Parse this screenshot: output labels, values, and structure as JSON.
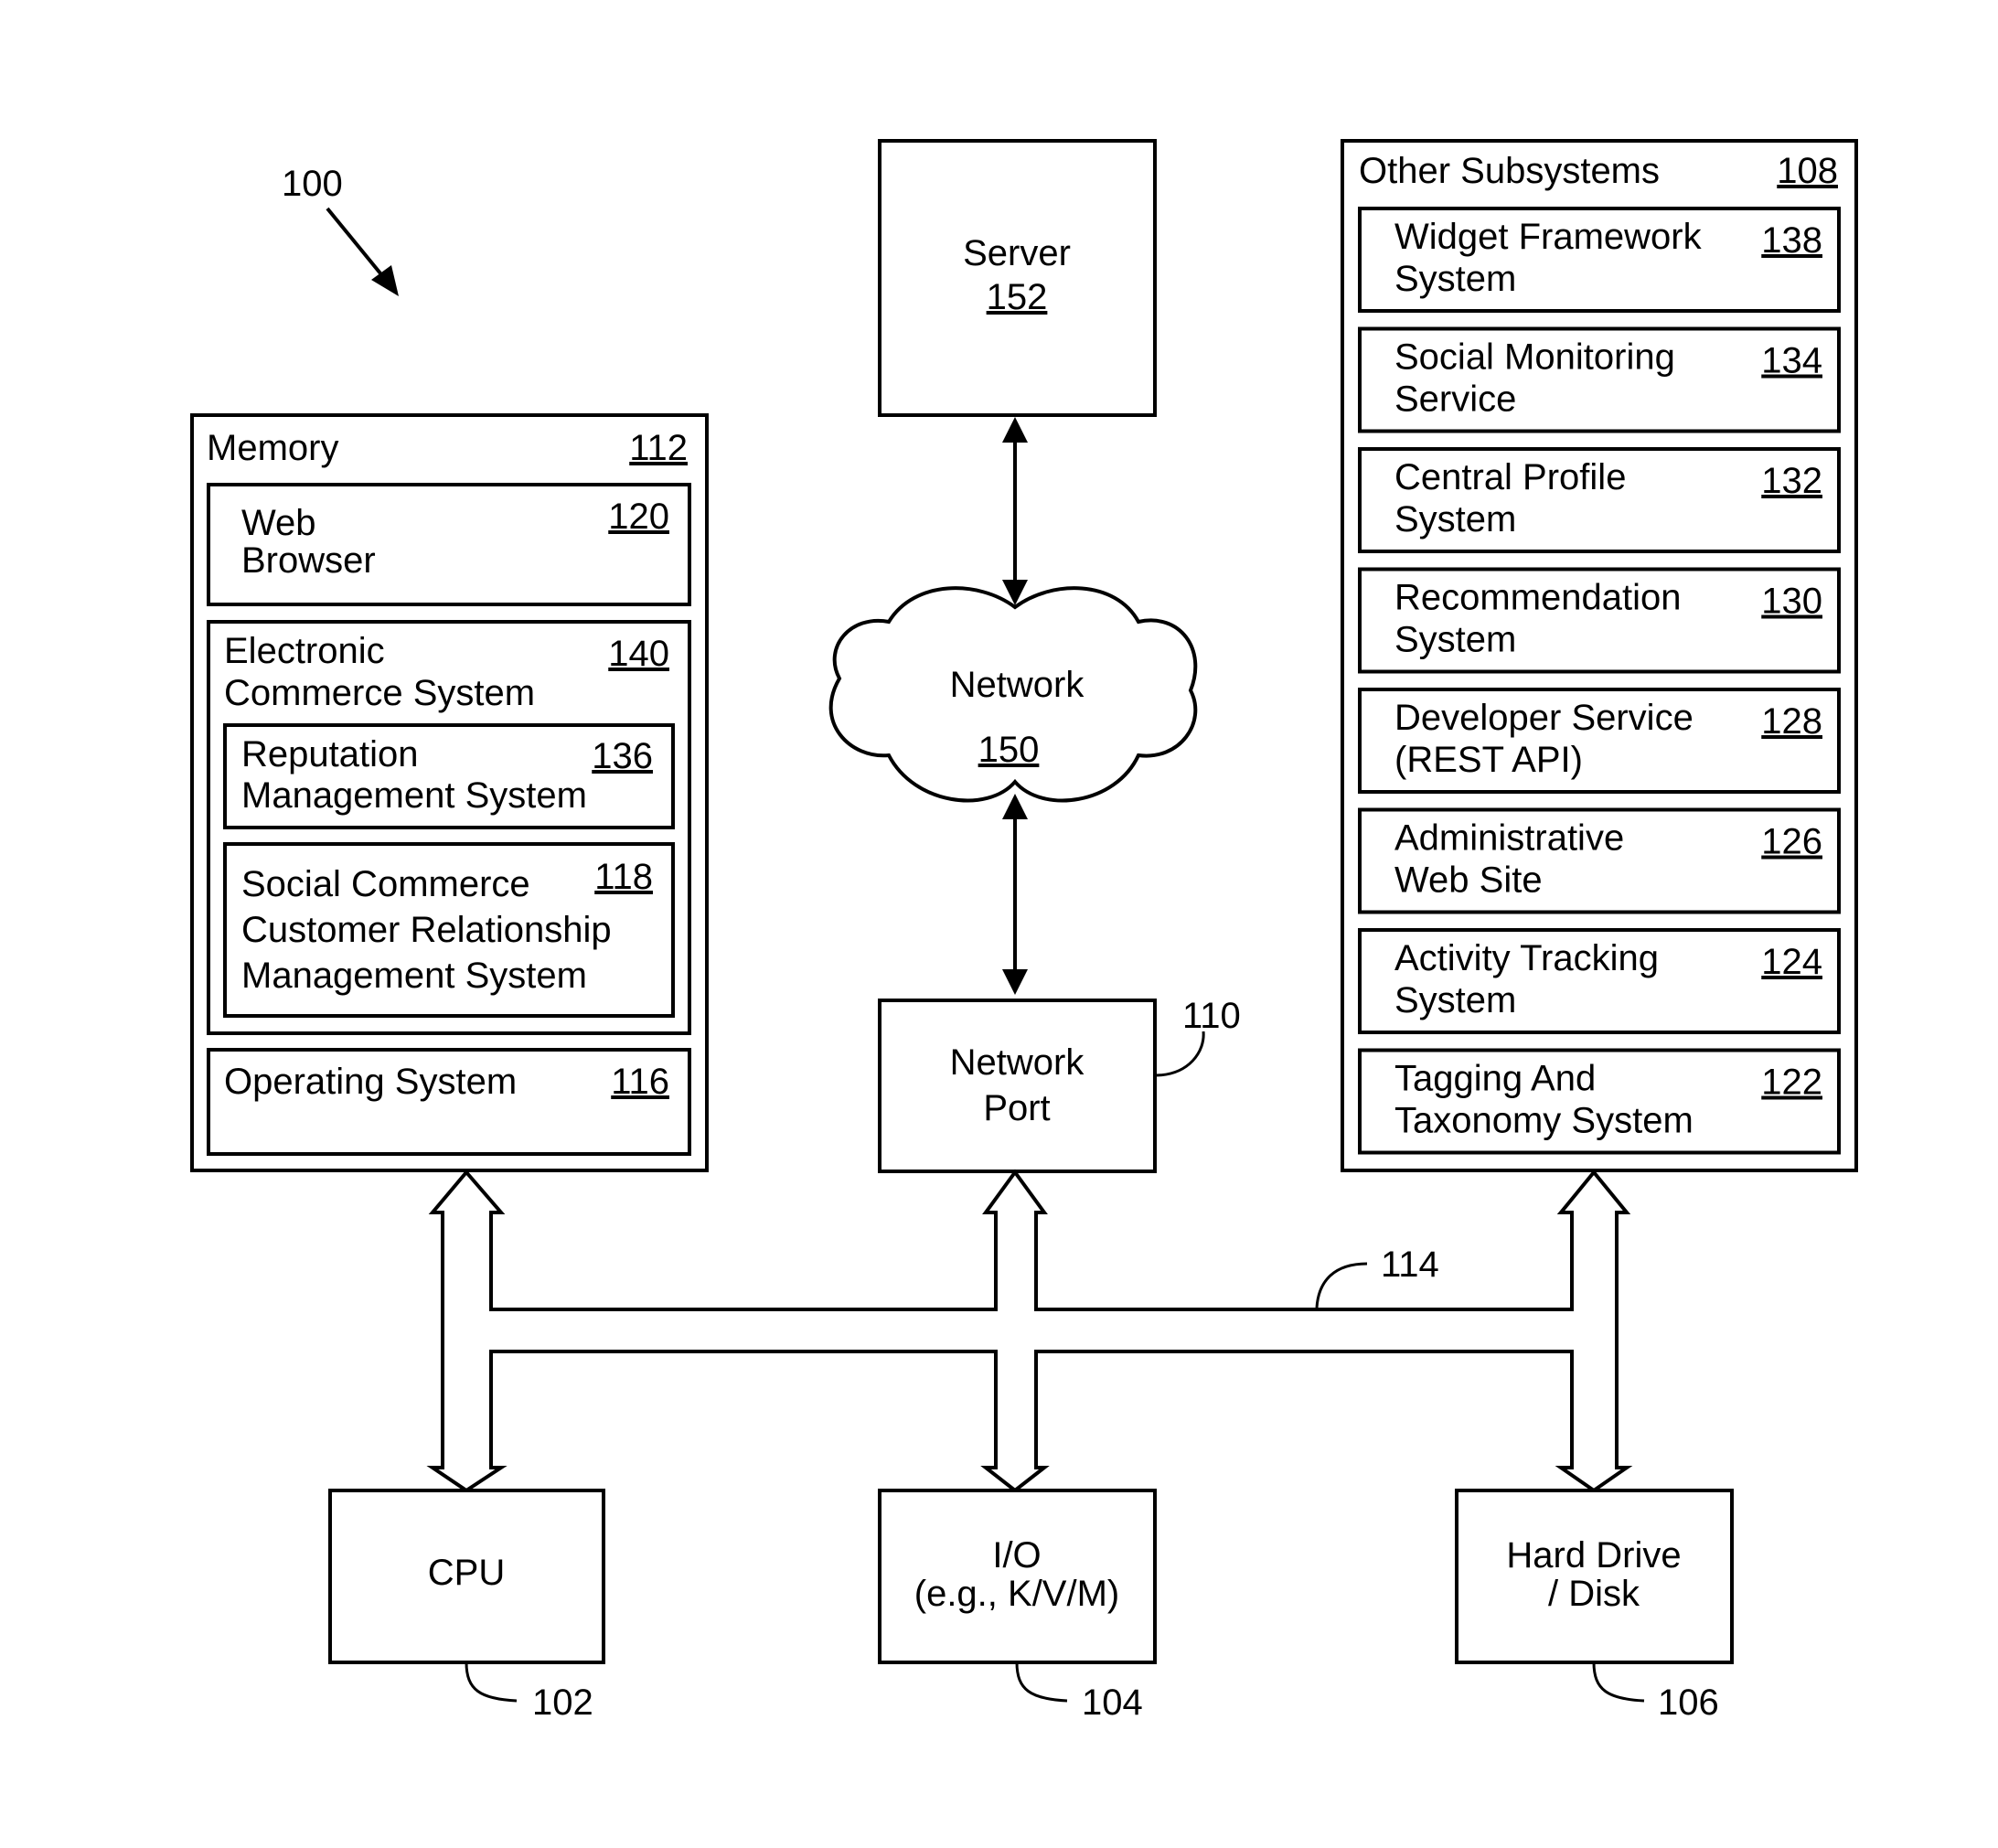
{
  "figure": {
    "reference": "100",
    "bus_ref": "114"
  },
  "memory": {
    "title": "Memory",
    "ref": "112",
    "web_browser": {
      "line1": "Web",
      "line2": "Browser",
      "ref": "120"
    },
    "ecommerce": {
      "line1": "Electronic",
      "line2": "Commerce System",
      "ref": "140",
      "reputation": {
        "line1": "Reputation",
        "line2": "Management System",
        "ref": "136"
      },
      "social_crm": {
        "line1": "Social Commerce",
        "line2": "Customer Relationship",
        "line3": "Management System",
        "ref": "118"
      }
    },
    "os": {
      "label": "Operating System",
      "ref": "116"
    }
  },
  "server": {
    "label": "Server",
    "ref": "152"
  },
  "network": {
    "label": "Network",
    "ref": "150"
  },
  "network_port": {
    "line1": "Network",
    "line2": "Port",
    "ref": "110"
  },
  "other_subsystems": {
    "title": "Other Subsystems",
    "ref": "108",
    "items": [
      {
        "line1": "Widget Framework",
        "line2": "System",
        "ref": "138"
      },
      {
        "line1": "Social Monitoring",
        "line2": "Service",
        "ref": "134"
      },
      {
        "line1": "Central Profile",
        "line2": "System",
        "ref": "132"
      },
      {
        "line1": "Recommendation",
        "line2": "System",
        "ref": "130"
      },
      {
        "line1": "Developer Service",
        "line2": "(REST API)",
        "ref": "128"
      },
      {
        "line1": "Administrative",
        "line2": "Web Site",
        "ref": "126"
      },
      {
        "line1": "Activity Tracking",
        "line2": "System",
        "ref": "124"
      },
      {
        "line1": "Tagging And",
        "line2": "Taxonomy System",
        "ref": "122"
      }
    ]
  },
  "cpu": {
    "label": "CPU",
    "ref": "102"
  },
  "io": {
    "line1": "I/O",
    "line2": "(e.g., K/V/M)",
    "ref": "104"
  },
  "hard_drive": {
    "line1": "Hard Drive",
    "line2": "/ Disk",
    "ref": "106"
  }
}
